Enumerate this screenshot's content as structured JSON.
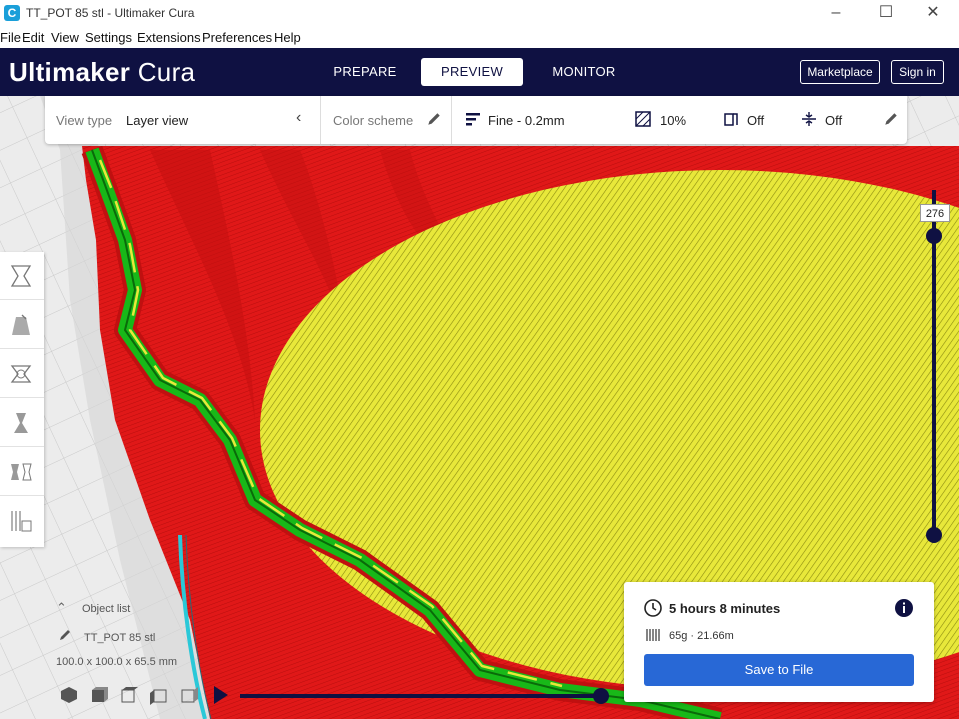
{
  "window": {
    "title": "TT_POT 85 stl - Ultimaker Cura",
    "app_icon_letter": "C"
  },
  "menu": [
    "File",
    "Edit",
    "View",
    "Settings",
    "Extensions",
    "Preferences",
    "Help"
  ],
  "header": {
    "brand_bold": "Ultimaker",
    "brand_light": "Cura",
    "tabs": [
      {
        "label": "PREPARE",
        "active": false
      },
      {
        "label": "PREVIEW",
        "active": true
      },
      {
        "label": "MONITOR",
        "active": false
      }
    ],
    "marketplace_label": "Marketplace",
    "signin_label": "Sign in"
  },
  "settings_bar": {
    "view_type_label": "View type",
    "view_type_value": "Layer view",
    "color_scheme_label": "Color scheme",
    "profile": "Fine - 0.2mm",
    "infill": "10%",
    "support": "Off",
    "adhesion": "Off"
  },
  "layer_slider": {
    "current_layer": "276"
  },
  "object_list": {
    "title": "Object list",
    "object_name": "TT_POT 85 stl",
    "dimensions": "100.0 x 100.0 x 65.5 mm"
  },
  "print_info": {
    "time": "5 hours 8 minutes",
    "material": "65g · 21.66m",
    "save_label": "Save to File"
  },
  "colors": {
    "header": "#0f1142",
    "accent": "#2868d6",
    "wall_outer": "#e82020",
    "wall_inner": "#20c020",
    "infill": "#e6e62a",
    "travel": "#2ac8d8"
  },
  "icons": [
    "close-icon",
    "maximize-icon",
    "minimize-icon",
    "chevron-left-icon",
    "pencil-icon",
    "profile-icon",
    "infill-icon",
    "support-icon",
    "adhesion-icon",
    "clock-icon",
    "info-icon",
    "spool-icon",
    "chevron-up-icon",
    "play-icon"
  ]
}
